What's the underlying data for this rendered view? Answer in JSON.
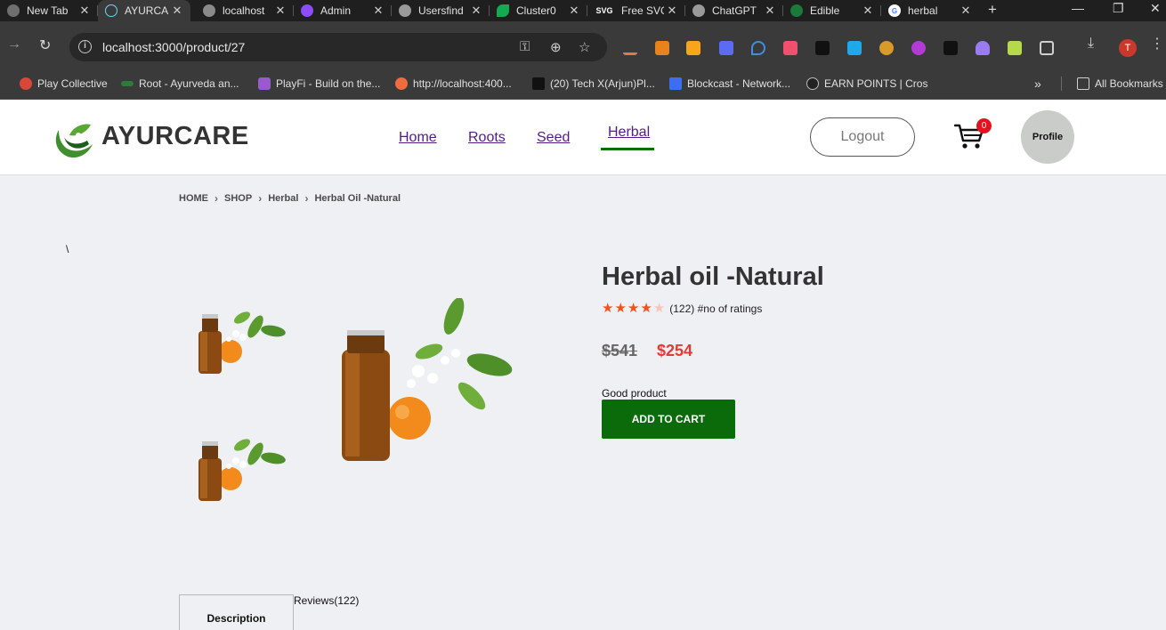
{
  "browser": {
    "tabs": [
      {
        "title": "New Tab",
        "color": "#6f6f6f",
        "glyph": ""
      },
      {
        "title": "AYURCARE",
        "color": "#61dafb",
        "glyph": ""
      },
      {
        "title": "localhost",
        "color": "#8a8a8a",
        "glyph": ""
      },
      {
        "title": "Admin",
        "color": "#8c4bff",
        "glyph": ""
      },
      {
        "title": "Usersfind",
        "color": "#9a9a9a",
        "glyph": ""
      },
      {
        "title": "Cluster0",
        "color": "#13aa52",
        "glyph": ""
      },
      {
        "title": "Free SVG",
        "color": "#1f1f1f",
        "glyph": "SVG"
      },
      {
        "title": "ChatGPT",
        "color": "#9a9a9a",
        "glyph": ""
      },
      {
        "title": "Edible",
        "color": "#1b7a3a",
        "glyph": ""
      },
      {
        "title": "herbal",
        "color": "#4285f4",
        "glyph": "G"
      }
    ],
    "address": "localhost:3000/product/27",
    "bookmarks": [
      {
        "label": "Play Collective",
        "color": "#d9473a"
      },
      {
        "label": "Root - Ayurveda an...",
        "color": "#2f7a3a"
      },
      {
        "label": "PlayFi - Build on the...",
        "color": "#9b59d0"
      },
      {
        "label": "http://localhost:400...",
        "color": "#ef6c3c"
      },
      {
        "label": "(20) Tech X(Arjun)Pl...",
        "color": "#111111"
      },
      {
        "label": "Blockcast - Network...",
        "color": "#3b6ff0"
      },
      {
        "label": "EARN POINTS | Cros",
        "color": "#222222"
      }
    ],
    "all_bookmarks": "All Bookmarks",
    "profile_initial": "T"
  },
  "header": {
    "brand": "AYURCARE",
    "nav": {
      "home": "Home",
      "roots": "Roots",
      "seed": "Seed",
      "herbal": "Herbal"
    },
    "logout": "Logout",
    "cart_count": "0",
    "profile": "Profile"
  },
  "breadcrumb": {
    "home": "HOME",
    "shop": "SHOP",
    "category": "Herbal",
    "current": "Herbal Oil -Natural"
  },
  "stray_text": "\\",
  "product": {
    "title": "Herbal oil -Natural",
    "rating_stars": 4,
    "rating_max": 5,
    "rating_text": "(122) #no of ratings",
    "old_price": "$541",
    "new_price": "$254",
    "description": "Good product",
    "add_to_cart": "ADD TO CART"
  },
  "tabs": {
    "description": "Description",
    "reviews": "Reviews(122)"
  },
  "colors": {
    "accent_green": "#0b6b0b",
    "price_red": "#e53935",
    "star": "#f4511e",
    "star_empty": "#f5c6b8"
  }
}
